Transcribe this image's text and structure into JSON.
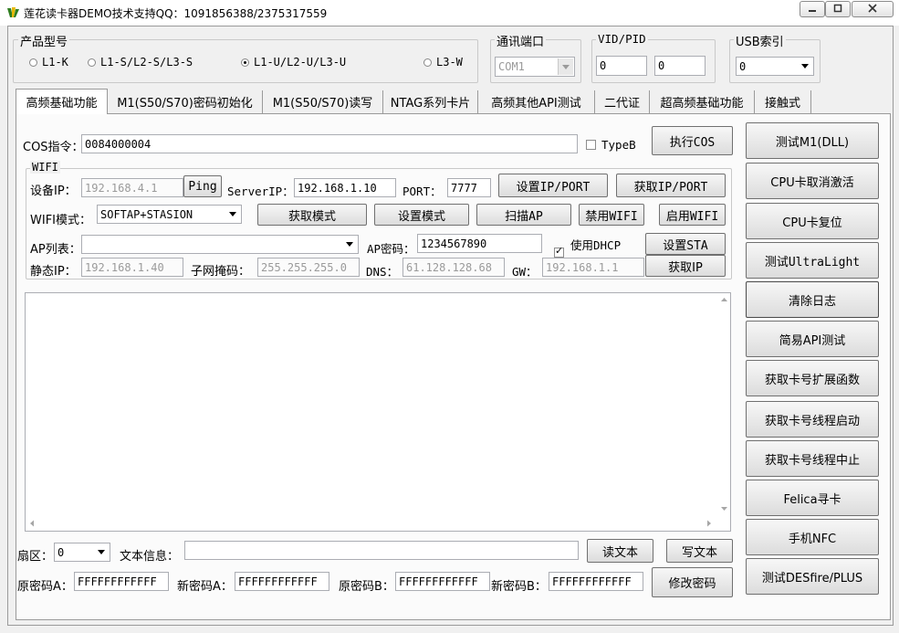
{
  "window": {
    "title": "莲花读卡器DEMO技术支持QQ：1091856388/2375317559",
    "min_icon": "minimize-icon",
    "max_icon": "maximize-icon",
    "close_icon": "close-icon"
  },
  "product": {
    "legend": "产品型号",
    "options": [
      "L1-K",
      "L1-S/L2-S/L3-S",
      "L1-U/L2-U/L3-U",
      "L3-W"
    ],
    "selected": "L1-U/L2-U/L3-U"
  },
  "comm_port": {
    "legend": "通讯端口",
    "value": "COM1"
  },
  "vid_pid": {
    "legend": "VID/PID",
    "vid": "0",
    "pid": "0"
  },
  "usb_index": {
    "legend": "USB索引",
    "value": "0"
  },
  "tabs": [
    "高频基础功能",
    "M1(S50/S70)密码初始化",
    "M1(S50/S70)读写",
    "NTAG系列卡片",
    "高频其他API测试",
    "二代证",
    "超高频基础功能",
    "接触式"
  ],
  "active_tab": "高频基础功能",
  "cos": {
    "label": "COS指令：",
    "value": "0084000004",
    "typeb_label": "TypeB",
    "typeb_checked": false,
    "exec_label": "执行COS"
  },
  "wifi": {
    "legend": "WIFI",
    "device_ip_label": "设备IP：",
    "device_ip": "192.168.4.1",
    "ping_label": "Ping",
    "server_ip_label": "ServerIP：",
    "server_ip": "192.168.1.10",
    "port_label": "PORT：",
    "port": "7777",
    "set_ip_port": "设置IP/PORT",
    "get_ip_port": "获取IP/PORT",
    "mode_label": "WIFI模式：",
    "mode_value": "SOFTAP+STASION",
    "get_mode": "获取模式",
    "set_mode": "设置模式",
    "scan_ap": "扫描AP",
    "disable_wifi": "禁用WIFI",
    "enable_wifi": "启用WIFI",
    "ap_list_label": "AP列表：",
    "ap_list_value": "",
    "ap_pwd_label": "AP密码：",
    "ap_pwd": "1234567890",
    "dhcp_label": "使用DHCP",
    "dhcp_checked": true,
    "set_sta": "设置STA",
    "static_ip_label": "静态IP：",
    "static_ip": "192.168.1.40",
    "mask_label": "子网掩码：",
    "mask": "255.255.255.0",
    "dns_label": "DNS：",
    "dns": "61.128.128.68",
    "gw_label": "GW：",
    "gw": "192.168.1.1",
    "get_ip": "获取IP"
  },
  "sector": {
    "label": "扇区：",
    "value": "0"
  },
  "text_info": {
    "label": "文本信息：",
    "value": "",
    "read": "读文本",
    "write": "写文本"
  },
  "passwords": {
    "old_a_label": "原密码A：",
    "old_a": "FFFFFFFFFFFF",
    "new_a_label": "新密码A：",
    "new_a": "FFFFFFFFFFFF",
    "old_b_label": "原密码B：",
    "old_b": "FFFFFFFFFFFF",
    "new_b_label": "新密码B：",
    "new_b": "FFFFFFFFFFFF",
    "modify": "修改密码"
  },
  "side_buttons": [
    "测试M1(DLL)",
    "CPU卡取消激活",
    "CPU卡复位",
    "测试UltraLight",
    "清除日志",
    "简易API测试",
    "获取卡号扩展函数",
    "获取卡号线程启动",
    "获取卡号线程中止",
    "Felica寻卡",
    "手机NFC",
    "测试DESfire/PLUS"
  ]
}
